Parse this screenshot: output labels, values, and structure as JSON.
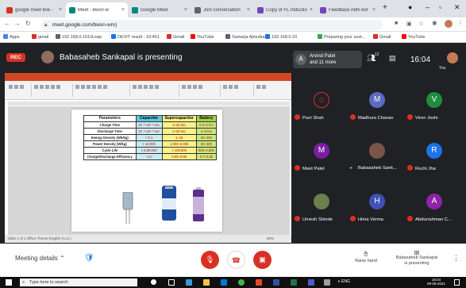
{
  "browser": {
    "tabs": [
      {
        "label": "google meet line - ",
        "color": "#d93025"
      },
      {
        "label": "Meet - bwsn-w",
        "color": "#00897b"
      },
      {
        "label": "Google Meet",
        "color": "#00897b"
      },
      {
        "label": "Join conversation",
        "color": "#5f6368"
      },
      {
        "label": "Copy of FL Inductio",
        "color": "#7248b9"
      },
      {
        "label": "Feedback Abhi kor",
        "color": "#7248b9"
      }
    ],
    "new_tab": "+",
    "url": "meet.google.com/bwsn-wnrj",
    "bookmarks": [
      {
        "label": "Apps",
        "color": "#4285f4"
      },
      {
        "label": "gmail",
        "color": "#d93025"
      },
      {
        "label": "192.168.0.101/iLeap",
        "color": "#5f6368"
      },
      {
        "label": "DEVIT result - 10:451",
        "color": "#1a73e8"
      },
      {
        "label": "Gmail",
        "color": "#d93025"
      },
      {
        "label": "YouTube",
        "color": "#ff0000"
      },
      {
        "label": "Samarja Ajmutkar",
        "color": "#5f6368"
      },
      {
        "label": "192.168.0.10",
        "color": "#1a73e8"
      },
      {
        "label": "Preparing your sust...",
        "color": "#34a853"
      },
      {
        "label": "Gmail",
        "color": "#d93025"
      },
      {
        "label": "YouTube",
        "color": "#ff0000"
      }
    ]
  },
  "meet": {
    "rec_label": "REC",
    "presenting_text": "Babasaheb Sankapal is presenting",
    "you_box": {
      "initial": "A",
      "line1": "Arvind Patel",
      "line2": "and 11 more"
    },
    "participant_count": "12",
    "time": "16:04",
    "self_label": "You"
  },
  "slide": {
    "table": {
      "headers": [
        "Parameters",
        "Capacitor",
        "Supercapacitor",
        "Battery"
      ],
      "rows": [
        [
          "Charge Time",
          "10⁻³~10⁻⁶ sec",
          "1~30 sec",
          "0.3~3 hrs"
        ],
        [
          "Discharge Time",
          "10⁻³~10⁻⁶ sec",
          "1~30 sec",
          "1~5 hrs"
        ],
        [
          "Energy Density (Wh/kg)",
          "< 0.1",
          "1~10",
          "20~100"
        ],
        [
          "Power Density (W/kg)",
          "> 10,000",
          "1,000~2,000",
          "50~200"
        ],
        [
          "Cycle Life",
          "> 5,00,000",
          "> 100,000",
          "500~2,000"
        ],
        [
          "Charge/Discharge Efficiency",
          "~1.0",
          "0.90~0.95",
          "0.7~0.85"
        ]
      ]
    },
    "status_left": "Slide 1 of 1   Office Theme   English (U.S.)",
    "status_right": "80%"
  },
  "participants": [
    {
      "name": "Puni Shah",
      "initial": "",
      "color": "#202124",
      "muted": true,
      "type": "emoji"
    },
    {
      "name": "Madhura Chavan",
      "initial": "M",
      "color": "#5c6bc0",
      "muted": true,
      "type": "initial"
    },
    {
      "name": "Viren Joshi",
      "initial": "V",
      "color": "#1e8e3e",
      "muted": true,
      "type": "initial"
    },
    {
      "name": "Meet Patel",
      "initial": "M",
      "color": "#7b1fa2",
      "muted": true,
      "type": "initial"
    },
    {
      "name": "Babasaheb Sank...",
      "initial": "",
      "color": "#795548",
      "muted": false,
      "type": "photo"
    },
    {
      "name": "Ruchi Jha",
      "initial": "R",
      "color": "#1a73e8",
      "muted": true,
      "type": "initial"
    },
    {
      "name": "Umesh Shinde",
      "initial": "",
      "color": "#6d7f4a",
      "muted": true,
      "type": "photo"
    },
    {
      "name": "Hima Verma",
      "initial": "H",
      "color": "#3f51b5",
      "muted": true,
      "type": "initial"
    },
    {
      "name": "Abdurrahman C...",
      "initial": "A",
      "color": "#8e24aa",
      "muted": true,
      "type": "initial"
    }
  ],
  "controls": {
    "meeting_details": "Meeting details",
    "raise_hand": "Raise hand",
    "presenter_line1": "Babasaheb Sankapal",
    "presenter_line2": "is presenting"
  },
  "taskbar": {
    "search_placeholder": "Type here to search",
    "tray_text": "∧ ENG",
    "time": "16:04",
    "date": "09-06-2021"
  },
  "colors": {
    "accent": "#1a73e8",
    "danger": "#d93025",
    "meet_bg": "#202124"
  }
}
